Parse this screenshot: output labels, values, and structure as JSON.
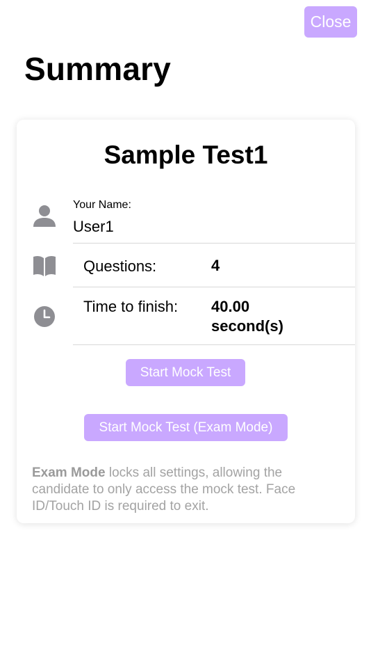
{
  "header": {
    "close_label": "Close",
    "title": "Summary"
  },
  "card": {
    "title": "Sample Test1",
    "name_label": "Your Name:",
    "name_value": "User1",
    "questions_label": "Questions:",
    "questions_value": "4",
    "time_label": "Time to finish:",
    "time_value_line1": "40.00",
    "time_value_line2": "second(s)",
    "start_button": "Start Mock Test",
    "exam_button": "Start Mock Test (Exam Mode)",
    "note_bold": "Exam Mode",
    "note_text": " locks all settings, allowing the candidate to only access the mock test. Face ID/Touch ID is required to exit."
  },
  "icons": {
    "user": "person-icon",
    "questions": "book-icon",
    "time": "clock-icon"
  },
  "colors": {
    "accent": "#c9a8ff",
    "icon": "#8e8e93",
    "note_text": "#a3a3a3"
  }
}
